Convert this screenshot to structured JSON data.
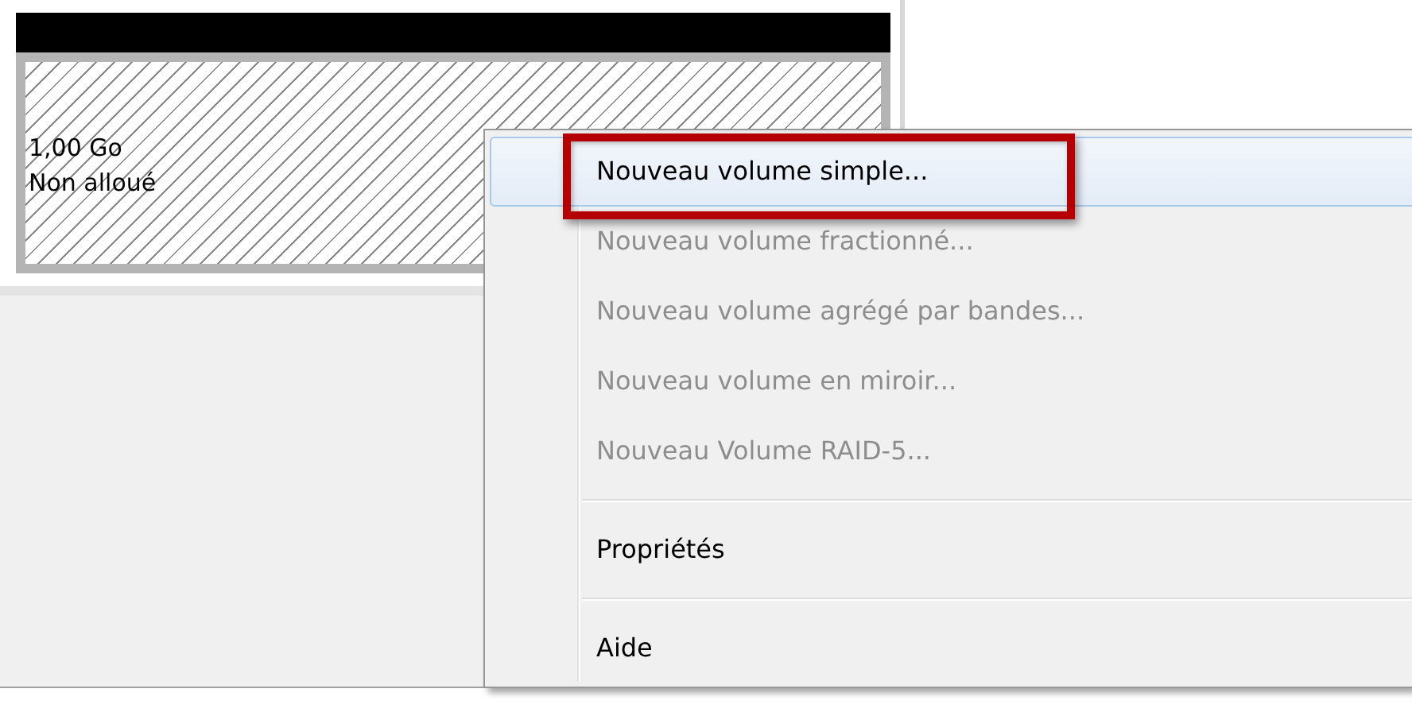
{
  "disk": {
    "size": "1,00 Go",
    "status": "Non alloué"
  },
  "context_menu": {
    "items": [
      {
        "kind": "item",
        "label": "Nouveau volume simple...",
        "disabled": false,
        "selected": true,
        "annotated": true
      },
      {
        "kind": "item",
        "label": "Nouveau volume fractionné...",
        "disabled": true,
        "selected": false,
        "annotated": false
      },
      {
        "kind": "item",
        "label": "Nouveau volume agrégé par bandes...",
        "disabled": true,
        "selected": false,
        "annotated": false
      },
      {
        "kind": "item",
        "label": "Nouveau volume en miroir...",
        "disabled": true,
        "selected": false,
        "annotated": false
      },
      {
        "kind": "item",
        "label": "Nouveau Volume RAID-5...",
        "disabled": true,
        "selected": false,
        "annotated": false
      },
      {
        "kind": "separator"
      },
      {
        "kind": "item",
        "label": "Propriétés",
        "disabled": false,
        "selected": false,
        "annotated": false
      },
      {
        "kind": "separator"
      },
      {
        "kind": "item",
        "label": "Aide",
        "disabled": false,
        "selected": false,
        "annotated": false
      }
    ]
  }
}
